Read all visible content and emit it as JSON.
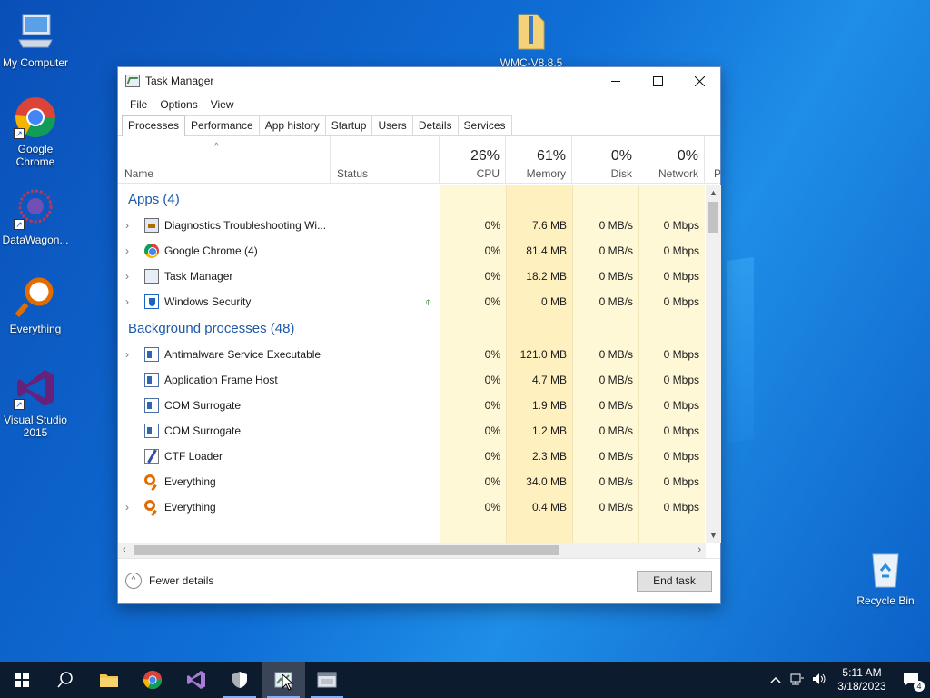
{
  "desktop": {
    "icons": [
      {
        "label": "My Computer"
      },
      {
        "label": "Google Chrome"
      },
      {
        "label": "DataWagon..."
      },
      {
        "label": "Everything"
      },
      {
        "label": "Visual Studio 2015"
      },
      {
        "label": "WMC-V8.8.5"
      },
      {
        "label": "Recycle Bin"
      }
    ]
  },
  "window": {
    "title": "Task Manager",
    "menu": [
      "File",
      "Options",
      "View"
    ],
    "tabs": [
      "Processes",
      "Performance",
      "App history",
      "Startup",
      "Users",
      "Details",
      "Services"
    ],
    "active_tab": "Processes",
    "columns": {
      "name": "Name",
      "status": "Status",
      "cpu": {
        "pct": "26%",
        "label": "CPU"
      },
      "memory": {
        "pct": "61%",
        "label": "Memory"
      },
      "disk": {
        "pct": "0%",
        "label": "Disk"
      },
      "network": {
        "pct": "0%",
        "label": "Network"
      },
      "power": "P"
    },
    "groups": {
      "apps": "Apps (4)",
      "background": "Background processes (48)"
    },
    "apps": [
      {
        "name": "Diagnostics Troubleshooting Wi...",
        "cpu": "0%",
        "mem": "7.6 MB",
        "disk": "0 MB/s",
        "net": "0 Mbps"
      },
      {
        "name": "Google Chrome (4)",
        "cpu": "0%",
        "mem": "81.4 MB",
        "disk": "0 MB/s",
        "net": "0 Mbps"
      },
      {
        "name": "Task Manager",
        "cpu": "0%",
        "mem": "18.2 MB",
        "disk": "0 MB/s",
        "net": "0 Mbps"
      },
      {
        "name": "Windows Security",
        "cpu": "0%",
        "mem": "0 MB",
        "disk": "0 MB/s",
        "net": "0 Mbps"
      }
    ],
    "background": [
      {
        "name": "Antimalware Service Executable",
        "cpu": "0%",
        "mem": "121.0 MB",
        "disk": "0 MB/s",
        "net": "0 Mbps"
      },
      {
        "name": "Application Frame Host",
        "cpu": "0%",
        "mem": "4.7 MB",
        "disk": "0 MB/s",
        "net": "0 Mbps"
      },
      {
        "name": "COM Surrogate",
        "cpu": "0%",
        "mem": "1.9 MB",
        "disk": "0 MB/s",
        "net": "0 Mbps"
      },
      {
        "name": "COM Surrogate",
        "cpu": "0%",
        "mem": "1.2 MB",
        "disk": "0 MB/s",
        "net": "0 Mbps"
      },
      {
        "name": "CTF Loader",
        "cpu": "0%",
        "mem": "2.3 MB",
        "disk": "0 MB/s",
        "net": "0 Mbps"
      },
      {
        "name": "Everything",
        "cpu": "0%",
        "mem": "34.0 MB",
        "disk": "0 MB/s",
        "net": "0 Mbps"
      },
      {
        "name": "Everything",
        "cpu": "0%",
        "mem": "0.4 MB",
        "disk": "0 MB/s",
        "net": "0 Mbps"
      }
    ],
    "footer": {
      "fewer_details": "Fewer details",
      "end_task": "End task"
    }
  },
  "taskbar": {
    "time": "5:11 AM",
    "date": "3/18/2023",
    "notifications": "4"
  }
}
